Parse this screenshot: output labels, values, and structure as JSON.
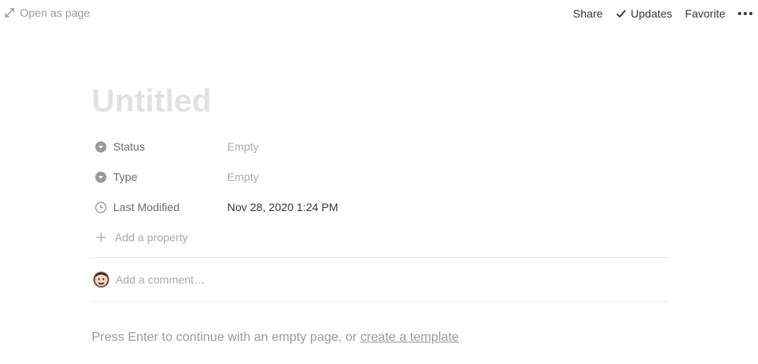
{
  "topbar": {
    "open_as_page": "Open as page",
    "share": "Share",
    "updates": "Updates",
    "favorite": "Favorite"
  },
  "page": {
    "title_placeholder": "Untitled",
    "properties": [
      {
        "name": "Status",
        "value": "Empty",
        "icon": "select-icon"
      },
      {
        "name": "Type",
        "value": "Empty",
        "icon": "select-icon"
      },
      {
        "name": "Last Modified",
        "value": "Nov 28, 2020 1:24 PM",
        "icon": "clock-icon"
      }
    ],
    "add_property": "Add a property",
    "comment_placeholder": "Add a comment…",
    "hint_prefix": "Press Enter to continue with an empty page, or ",
    "hint_link": "create a template"
  }
}
